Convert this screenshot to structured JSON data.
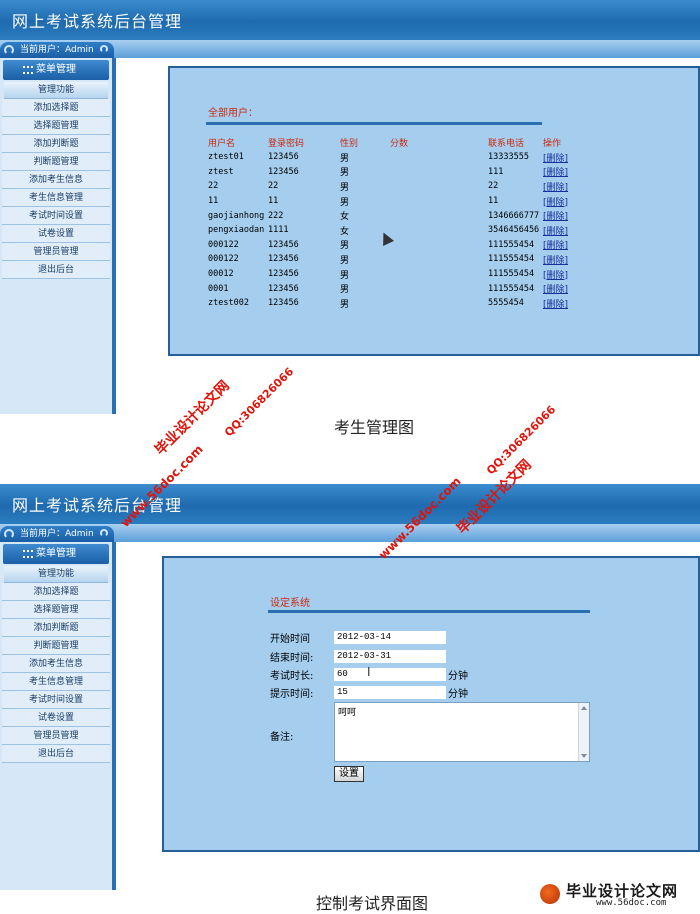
{
  "app_title": "网上考试系统后台管理",
  "current_user": "当前用户：Admin",
  "menu_header": "菜单管理",
  "menu_section": "管理功能",
  "menu_items": [
    "添加选择题",
    "选择题管理",
    "添加判断题",
    "判断题管理",
    "添加考生信息",
    "考生信息管理",
    "考试时间设置",
    "试卷设置",
    "管理员管理",
    "退出后台"
  ],
  "users_panel": {
    "title": "全部用户：",
    "headers": [
      "用户名",
      "登录密码",
      "性别",
      "分数",
      "联系电话",
      "操作"
    ],
    "rows": [
      {
        "username": "ztest01",
        "password": "123456",
        "gender": "男",
        "score": "",
        "phone": "13333555",
        "action": "[删除]"
      },
      {
        "username": "ztest",
        "password": "123456",
        "gender": "男",
        "score": "",
        "phone": "111",
        "action": "[删除]"
      },
      {
        "username": "22",
        "password": "22",
        "gender": "男",
        "score": "",
        "phone": "22",
        "action": "[删除]"
      },
      {
        "username": "11",
        "password": "11",
        "gender": "男",
        "score": "",
        "phone": "11",
        "action": "[删除]"
      },
      {
        "username": "gaojianhong",
        "password": "222",
        "gender": "女",
        "score": "",
        "phone": "1346666777",
        "action": "[删除]"
      },
      {
        "username": "pengxiaodan",
        "password": "1111",
        "gender": "女",
        "score": "",
        "phone": "3546456456",
        "action": "[删除]"
      },
      {
        "username": "000122",
        "password": "123456",
        "gender": "男",
        "score": "",
        "phone": "111555454",
        "action": "[删除]"
      },
      {
        "username": "000122",
        "password": "123456",
        "gender": "男",
        "score": "",
        "phone": "111555454",
        "action": "[删除]"
      },
      {
        "username": "00012",
        "password": "123456",
        "gender": "男",
        "score": "",
        "phone": "111555454",
        "action": "[删除]"
      },
      {
        "username": "0001",
        "password": "123456",
        "gender": "男",
        "score": "",
        "phone": "111555454",
        "action": "[删除]"
      },
      {
        "username": "ztest002",
        "password": "123456",
        "gender": "男",
        "score": "",
        "phone": "5555454",
        "action": "[删除]"
      }
    ]
  },
  "caption_top": "考生管理图",
  "settings_panel": {
    "title": "设定系统",
    "start_label": "开始时间",
    "start_value": "2012-03-14",
    "end_label": "结束时间:",
    "end_value": "2012-03-31",
    "duration_label": "考试时长:",
    "duration_value": "60",
    "duration_unit": "分钟",
    "reminder_label": "提示时间:",
    "reminder_value": "15",
    "reminder_unit": "分钟",
    "remark_label": "备注:",
    "remark_value": "呵呵",
    "submit_label": "设置"
  },
  "caption_bottom": "控制考试界面图",
  "watermarks": {
    "site": "www.56doc.com",
    "qq": "QQ:306826066",
    "brand": "毕业设计论文网"
  },
  "footer_logo": {
    "main": "毕业设计论文网",
    "sub": "www.56doc.com"
  },
  "colors": {
    "header_blue": "#1f6aae",
    "panel_bg": "#a4cdee",
    "panel_border": "#245f9c",
    "label_red": "#cc2a10",
    "watermark_red": "#e0140a"
  }
}
